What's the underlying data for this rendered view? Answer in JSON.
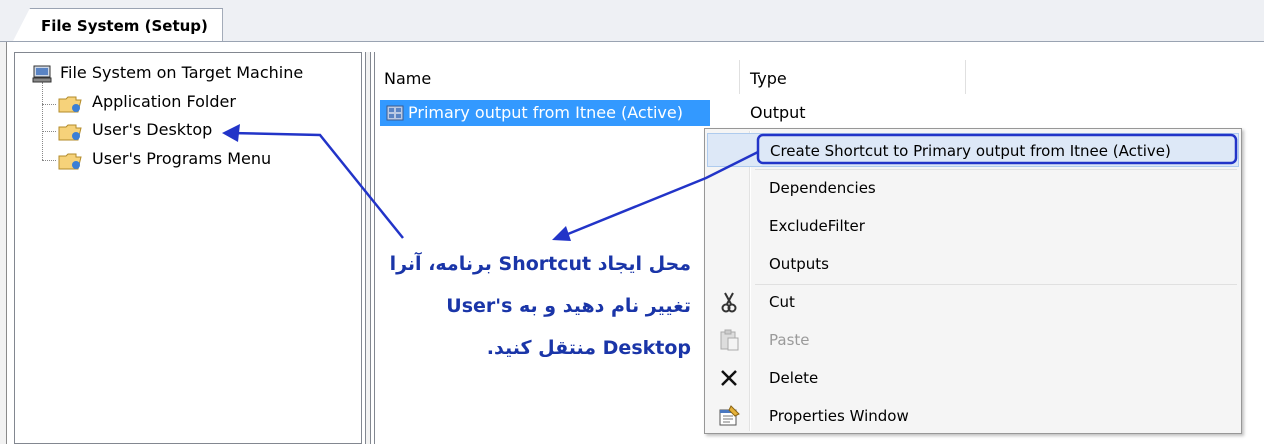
{
  "tab": {
    "label": "File System (Setup)"
  },
  "tree": {
    "root": "File System on Target Machine",
    "children": [
      "Application Folder",
      "User's Desktop",
      "User's Programs Menu"
    ]
  },
  "list": {
    "columns": [
      "Name",
      "Type"
    ],
    "rows": [
      {
        "name": "Primary output from Itnee (Active)",
        "type": "Output"
      }
    ]
  },
  "context_menu": {
    "items": [
      {
        "label": "Create Shortcut to Primary output from Itnee (Active)",
        "icon": "",
        "highlighted": true
      },
      {
        "label": "Dependencies",
        "icon": ""
      },
      {
        "label": "ExcludeFilter",
        "icon": ""
      },
      {
        "label": "Outputs",
        "icon": ""
      },
      {
        "label": "Cut",
        "icon": "scissors-icon"
      },
      {
        "label": "Paste",
        "icon": "clipboard-icon",
        "disabled": true
      },
      {
        "label": "Delete",
        "icon": "x-icon"
      },
      {
        "label": "Properties Window",
        "icon": "properties-icon"
      }
    ]
  },
  "annotation": {
    "line1": "محل ایجاد Shortcut برنامه، آنرا",
    "line2": "تغییر نام دهید و به  User's",
    "line3": "Desktop منتقل کنید."
  },
  "colors": {
    "selection": "#3399ff",
    "annotation": "#1a35a8",
    "highlight_box": "#2234c8"
  }
}
